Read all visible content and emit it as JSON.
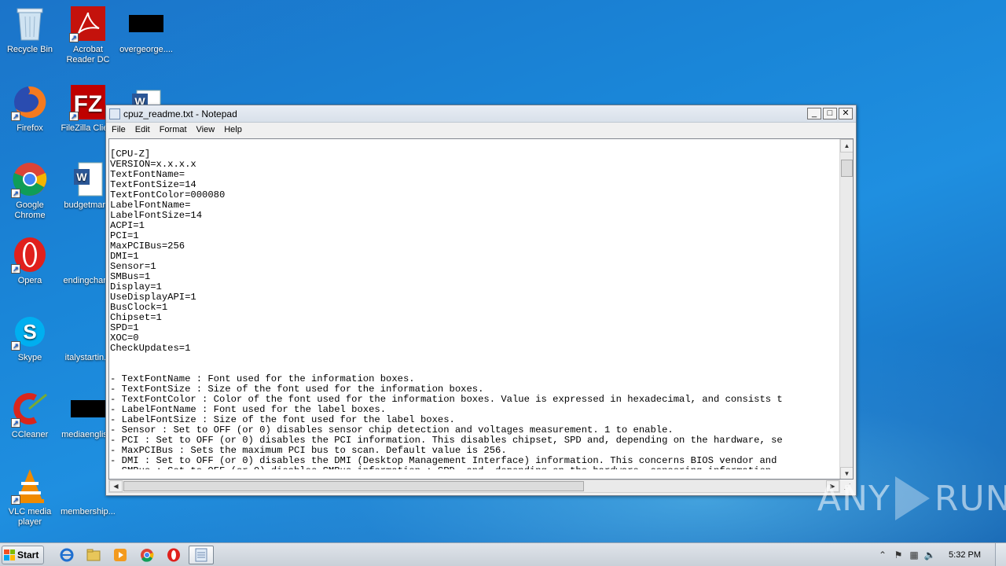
{
  "desktop_icons": [
    {
      "label": "Recycle Bin",
      "icon": "recycle-bin-icon"
    },
    {
      "label": "Acrobat Reader DC",
      "icon": "acrobat-icon"
    },
    {
      "label": "overgeorge....",
      "icon": "black-file-icon"
    },
    {
      "label": "Firefox",
      "icon": "firefox-icon"
    },
    {
      "label": "FileZilla Clie...",
      "icon": "filezilla-icon"
    },
    {
      "label": "Google Chrome",
      "icon": "chrome-icon"
    },
    {
      "label": "budgetmar...",
      "icon": "word-doc-icon"
    },
    {
      "label": "Opera",
      "icon": "opera-icon"
    },
    {
      "label": "endingchar...",
      "icon": "file-icon"
    },
    {
      "label": "Skype",
      "icon": "skype-icon"
    },
    {
      "label": "italystartin...",
      "icon": "file-icon"
    },
    {
      "label": "CCleaner",
      "icon": "ccleaner-icon"
    },
    {
      "label": "mediaenglis...",
      "icon": "black-file-icon"
    },
    {
      "label": "VLC media player",
      "icon": "vlc-icon"
    },
    {
      "label": "membership...",
      "icon": "file-icon"
    }
  ],
  "window": {
    "title": "cpuz_readme.txt - Notepad",
    "menu": [
      "File",
      "Edit",
      "Format",
      "View",
      "Help"
    ],
    "content": "\n[CPU-Z]\nVERSION=x.x.x.x\nTextFontName=\nTextFontSize=14\nTextFontColor=000080\nLabelFontName=\nLabelFontSize=14\nACPI=1\nPCI=1\nMaxPCIBus=256\nDMI=1\nSensor=1\nSMBus=1\nDisplay=1\nUseDisplayAPI=1\nBusClock=1\nChipset=1\nSPD=1\nXOC=0\nCheckUpdates=1\n\n\n- TextFontName : Font used for the information boxes.\n- TextFontSize : Size of the font used for the information boxes.\n- TextFontColor : Color of the font used for the information boxes. Value is expressed in hexadecimal, and consists t\n- LabelFontName : Font used for the label boxes.\n- LabelFontSize : Size of the font used for the label boxes.\n- Sensor : Set to OFF (or 0) disables sensor chip detection and voltages measurement. 1 to enable.\n- PCI : Set to OFF (or 0) disables the PCI information. This disables chipset, SPD and, depending on the hardware, se\n- MaxPCIBus : Sets the maximum PCI bus to scan. Default value is 256.\n- DMI : Set to OFF (or 0) disables the DMI (Desktop Management Interface) information. This concerns BIOS vendor and\n- SMBus : Set to OFF (or 0) disables SMBus information : SPD, and, depending on the hardware, sensoring information."
  },
  "taskbar": {
    "start_label": "Start",
    "clock": "5:32 PM"
  },
  "watermark": {
    "left": "ANY",
    "right": "RUN"
  }
}
